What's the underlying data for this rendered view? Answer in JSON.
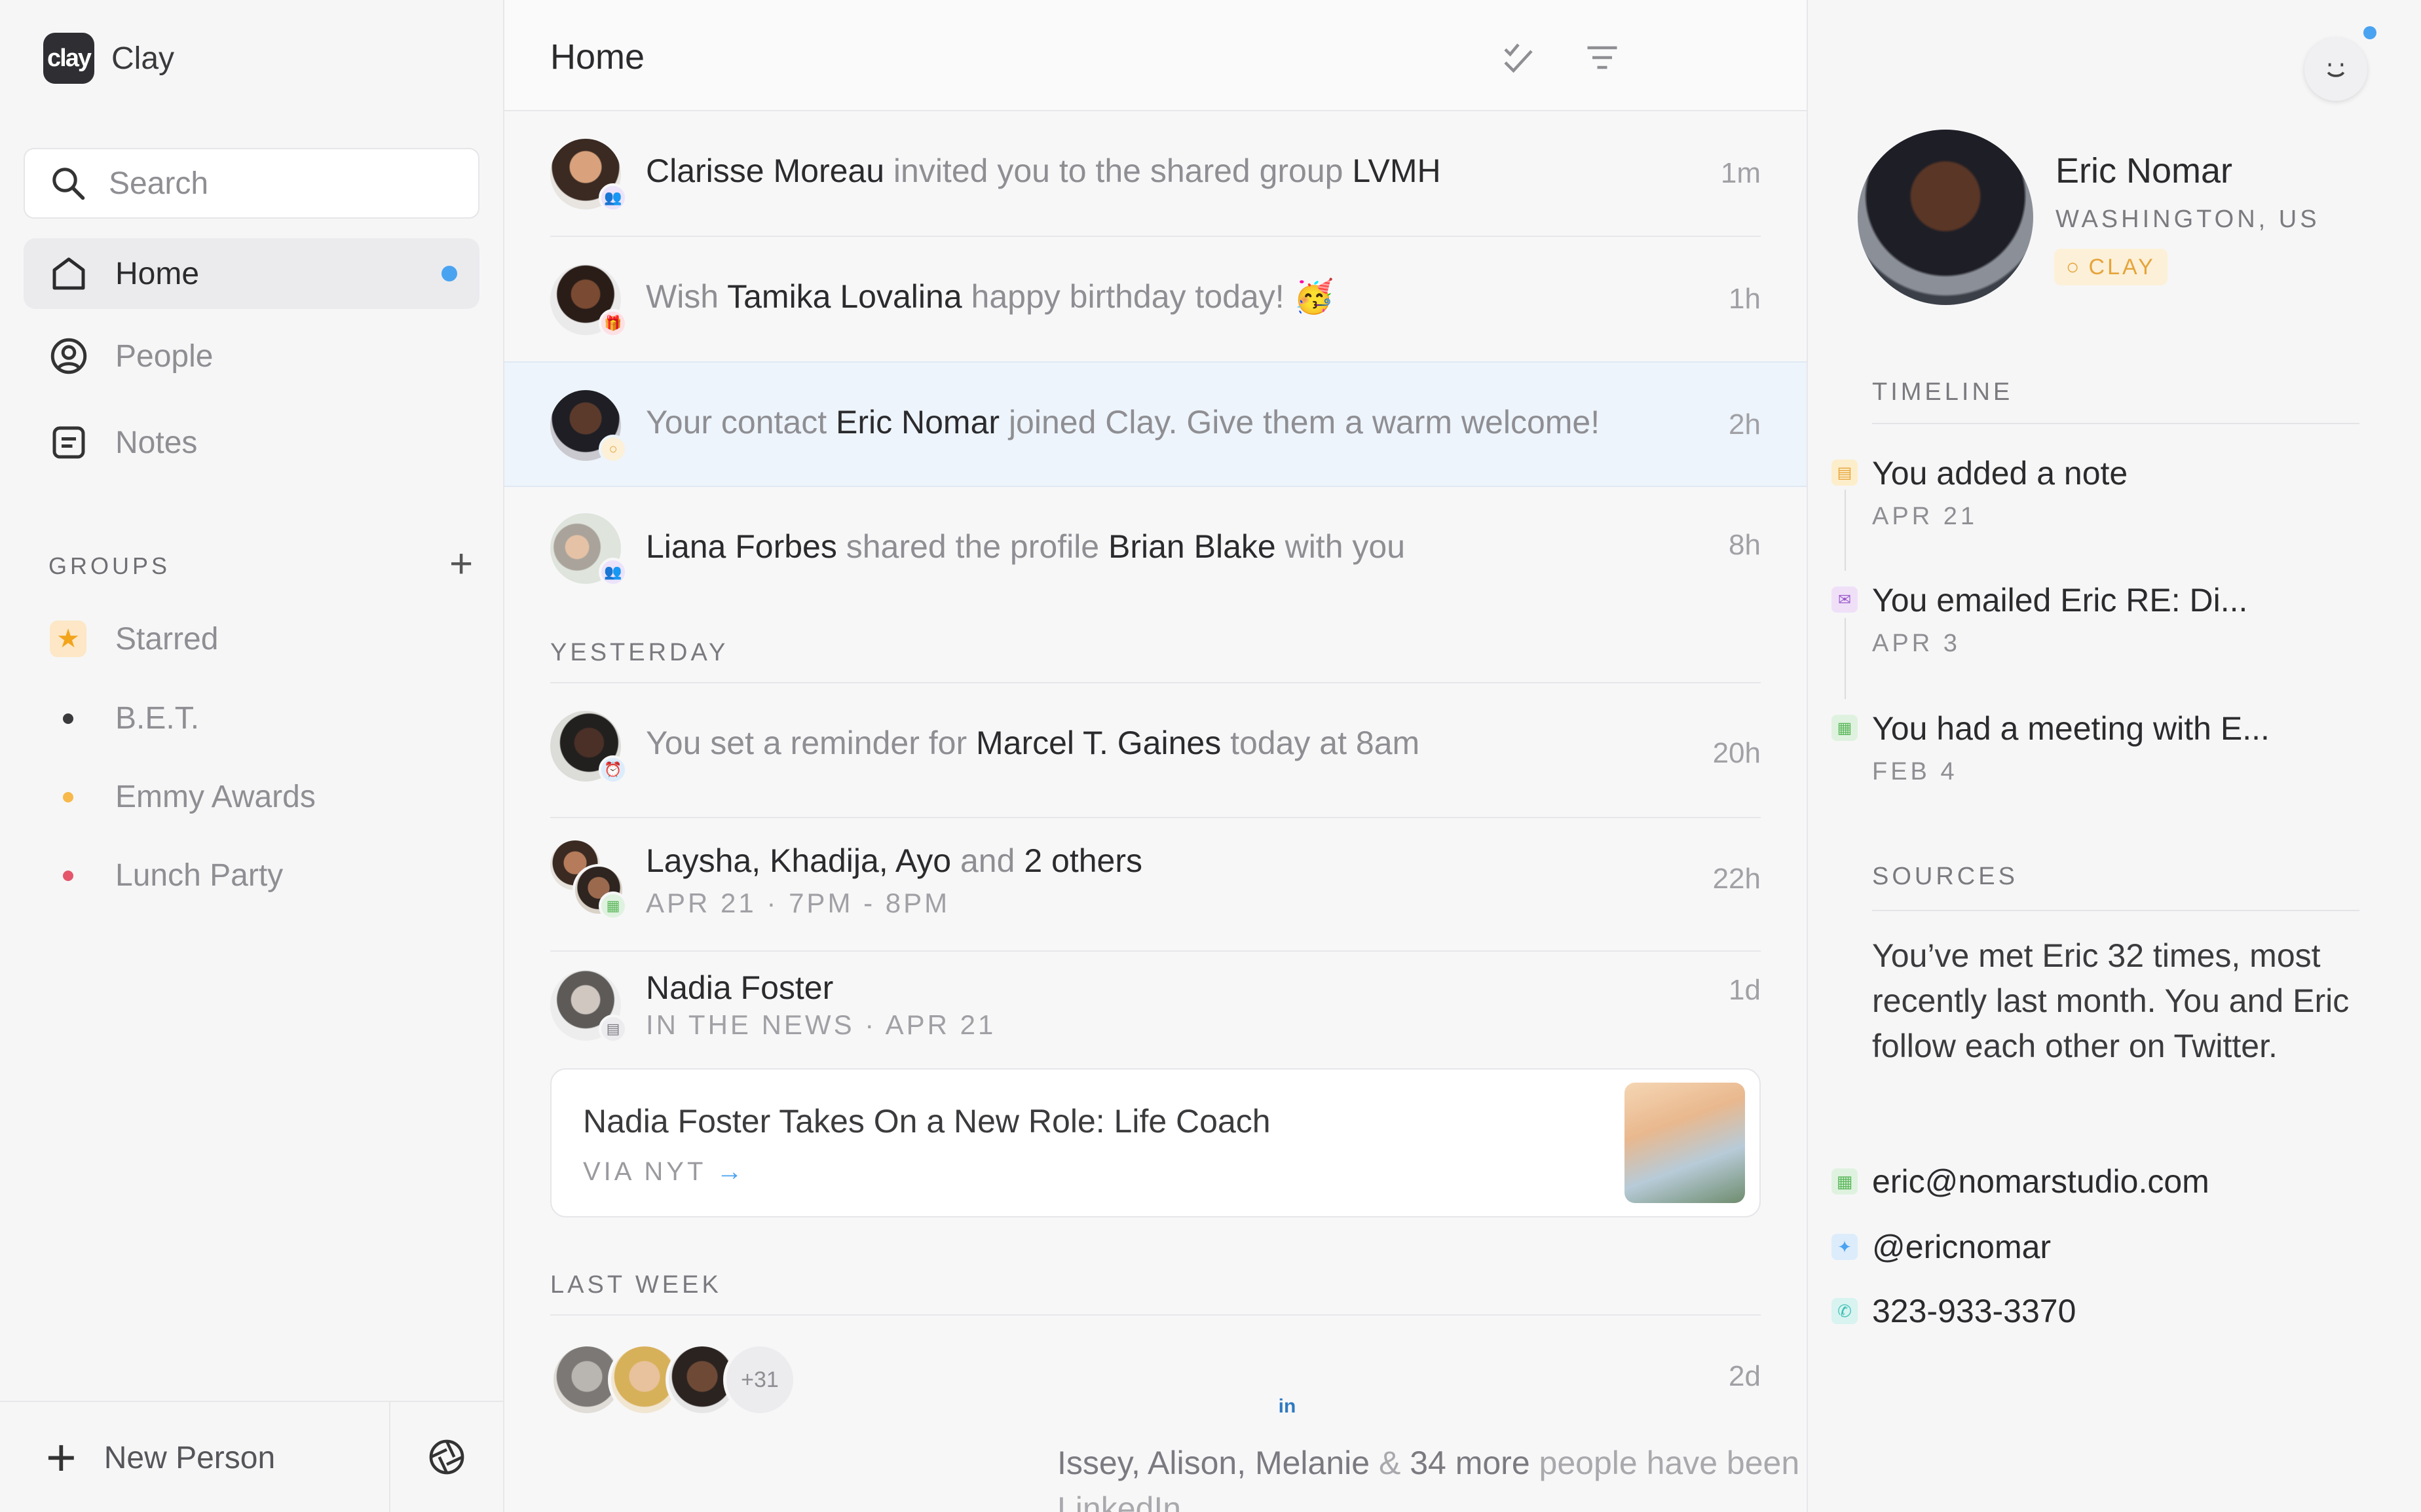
{
  "app": {
    "logo_text": "clay",
    "name": "Clay"
  },
  "sidebar": {
    "search_label": "Search",
    "nav": [
      {
        "label": "Home",
        "active": true,
        "has_dot": true
      },
      {
        "label": "People",
        "active": false
      },
      {
        "label": "Notes",
        "active": false
      }
    ],
    "groups_title": "GROUPS",
    "groups_add": "+",
    "groups": [
      {
        "label": "Starred",
        "icon": "star-icon",
        "color": "#f2a41b"
      },
      {
        "label": "B.E.T.",
        "color": "#3a3a3d"
      },
      {
        "label": "Emmy Awards",
        "color": "#f6b94a"
      },
      {
        "label": "Lunch Party",
        "color": "#e5566a"
      }
    ],
    "new_person_label": "New Person"
  },
  "feed": {
    "title": "Home",
    "rows": [
      {
        "name": "Clarisse Moreau",
        "text": " invited you to the shared group ",
        "target": "LVMH",
        "time": "1m"
      },
      {
        "pre": "Wish ",
        "name": "Tamika Lovalina",
        "text": " happy birthday today! 🥳",
        "time": "1h"
      },
      {
        "pre": "Your contact ",
        "name": "Eric Nomar",
        "text": " joined Clay. Give them a warm welcome!",
        "time": "2h"
      },
      {
        "name": "Liana Forbes",
        "text": " shared the profile ",
        "target": "Brian Blake",
        "post": " with you",
        "time": "8h"
      }
    ],
    "yesterday_label": "YESTERDAY",
    "yesterday_rows": [
      {
        "pre": "You set a reminder for ",
        "name": "Marcel T. Gaines",
        "text": " today at 8am",
        "time": "20h"
      },
      {
        "name": "Laysha, Khadija, Ayo",
        "text": " and ",
        "target": "2 others",
        "sub": "APR 21 · 7PM - 8PM",
        "time": "22h"
      },
      {
        "name": "Nadia Foster",
        "sub": "IN THE NEWS · APR 21",
        "time": "1d"
      }
    ],
    "news_card": {
      "title": "Nadia Foster Takes On a New Role: Life Coach",
      "via": "VIA NYT",
      "arrow": "→"
    },
    "last_week_label": "LAST WEEK",
    "last_week": {
      "more_count": "+31",
      "source_badge": "in",
      "time": "2d",
      "names": "Issey, Alison, Melanie",
      "amp": " & ",
      "more": "34 more",
      "text": " people have been added to your Clay via",
      "text2": "LinkedIn"
    }
  },
  "profile": {
    "name": "Eric Nomar",
    "location": "WASHINGTON, US",
    "tag": "CLAY",
    "timeline_label": "TIMELINE",
    "timeline": [
      {
        "title": "You added a note",
        "date": "APR 21",
        "icon": "note-icon",
        "color": "#f6b94a"
      },
      {
        "title": "You emailed Eric RE: Di...",
        "date": "APR 3",
        "icon": "mail-icon",
        "color": "#9b59c9"
      },
      {
        "title": "You had a meeting with E...",
        "date": "FEB 4",
        "icon": "calendar-icon",
        "color": "#5cb85c"
      }
    ],
    "sources_label": "SOURCES",
    "sources_text": "You’ve met Eric 32 times, most recently last month. You and Eric follow each other on Twitter.",
    "contacts": [
      {
        "label": "eric@nomarstudio.com",
        "icon": "calendar-icon",
        "color": "#5cb85c"
      },
      {
        "label": "@ericnomar",
        "icon": "twitter-icon",
        "color": "#4aa3f0"
      },
      {
        "label": "323-933-3370",
        "icon": "phone-icon",
        "color": "#3ec1b5"
      }
    ]
  }
}
